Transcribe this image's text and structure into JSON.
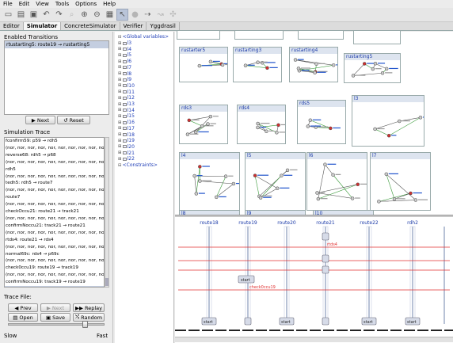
{
  "menu": [
    "File",
    "Edit",
    "View",
    "Tools",
    "Options",
    "Help"
  ],
  "tabs": [
    {
      "label": "Editor",
      "active": false
    },
    {
      "label": "Simulator",
      "active": true
    },
    {
      "label": "ConcreteSimulator",
      "active": false
    },
    {
      "label": "Verifier",
      "active": false
    },
    {
      "label": "Yggdrasil",
      "active": false
    }
  ],
  "simulator": {
    "enabled_title": "Enabled Transitions",
    "enabled_items": [
      "rtustarting5: route19 → rustarting5"
    ],
    "next_label": "Next",
    "reset_label": "Reset",
    "trace_title": "Simulation Trace",
    "trace_lines": [
      "fconfirm59: p59 → rdh5",
      "(nor, nor, nor, nor, nor, nor, nor, nor, nor, nor,",
      "reverse68: rdh5 → p68",
      "(nor, nor, nor, nor, nor, nor, nor, nor, nor, nor,",
      "rdh5",
      "(nor, nor, nor, nor, nor, nor, nor, nor, nor, nor,",
      "tedh5: rdh5 → route7",
      "(nor, nor, nor, nor, nor, nor, nor, nor, nor, nor,",
      "route7",
      "(nor, nor, nor, nor, nor, nor, nor, nor, nor, nor,",
      "checkOccu21: route21 → track21",
      "(nor, nor, nor, nor, nor, nor, nor, nor, nor, nor,",
      "confirmNoccu21: track21 → route21",
      "(nor, nor, nor, nor, nor, nor, nor, nor, nor, nor,",
      "rtds4: route21 → rds4",
      "(nor, nor, nor, nor, nor, nor, nor, nor, nor, nor,",
      "normal69c: rds4 → p69c",
      "(nor, nor, nor, nor, nor, nor, nor, nor, nor, nor,",
      "check0ccu19: route19 → track19",
      "(nor, nor, nor, nor, nor, nor, nor, nor, nor, nor,",
      "confirmNoccu19: track19 → route19",
      "(nor, nor, nor, nor, nor, nor, nor, nor, nor, nor,"
    ],
    "trace_file_label": "Trace File:",
    "prev_label": "Prev",
    "next2_label": "Next",
    "replay_label": "Replay",
    "open_label": "Open",
    "save_label": "Save",
    "random_label": "Random",
    "slow_label": "Slow",
    "fast_label": "Fast",
    "speed_fraction": 0.85
  },
  "tree": {
    "global": "<Global variables>",
    "items": [
      "l3",
      "l4",
      "l5",
      "l6",
      "l7",
      "l8",
      "l9",
      "l10",
      "l11",
      "l12",
      "l13",
      "l14",
      "l15",
      "l16",
      "l17",
      "l18",
      "l19",
      "l20",
      "l21",
      "l22"
    ],
    "constraints": "<Constraints>"
  },
  "templates": [
    {
      "name": "rustarter5"
    },
    {
      "name": "rustarting3"
    },
    {
      "name": "rustarting4"
    },
    {
      "name": "rustarting5"
    },
    {
      "name": "rds3"
    },
    {
      "name": "rds4"
    },
    {
      "name": "rds5"
    },
    {
      "name": "l3"
    },
    {
      "name": "l4"
    },
    {
      "name": "l5"
    },
    {
      "name": "l6"
    },
    {
      "name": "l7"
    },
    {
      "name": "l8"
    },
    {
      "name": "l9"
    },
    {
      "name": "l10"
    }
  ],
  "sequence": {
    "lanes": [
      "route18",
      "route19",
      "route20",
      "route21",
      "route22",
      "rdh2"
    ],
    "messages": [
      "rtds4",
      "check0ccu19"
    ],
    "start_label": "start",
    "accent": "#e03030"
  },
  "colors": {
    "selection": "#c4cee0",
    "link": "#1b3aa8",
    "line": "#e03030"
  }
}
